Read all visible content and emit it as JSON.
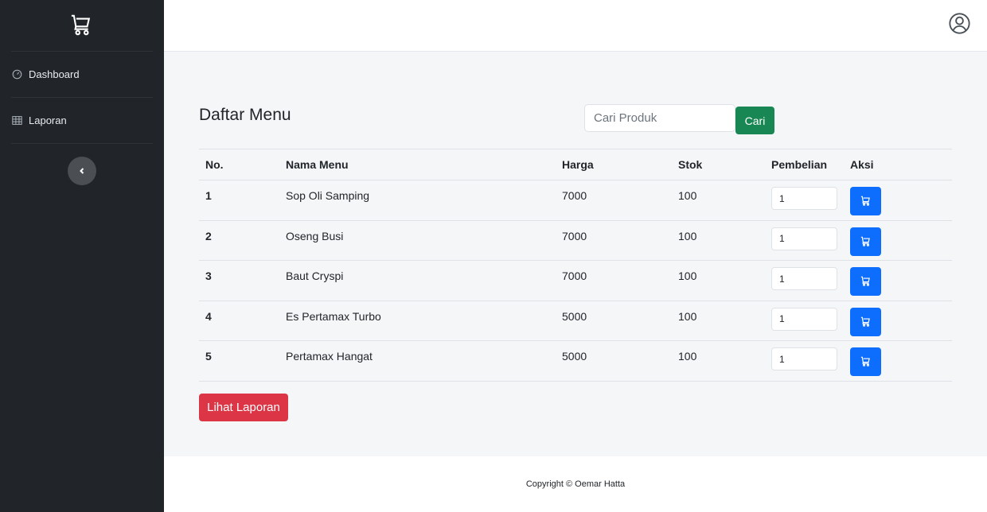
{
  "sidebar": {
    "brand_icon": "cart-icon",
    "items": [
      {
        "label": "Dashboard",
        "icon": "speedometer-icon"
      },
      {
        "label": "Laporan",
        "icon": "table-icon"
      }
    ],
    "toggle_icon": "chevron-left-icon"
  },
  "topbar": {
    "user_icon": "user-circle-icon"
  },
  "main": {
    "title": "Daftar Menu",
    "search": {
      "placeholder": "Cari Produk",
      "value": "",
      "button_label": "Cari"
    },
    "table": {
      "headers": [
        "No.",
        "Nama Menu",
        "Harga",
        "Stok",
        "Pembelian",
        "Aksi"
      ],
      "rows": [
        {
          "no": "1",
          "name": "Sop Oli Samping",
          "price": "7000",
          "stock": "100",
          "qty": "1"
        },
        {
          "no": "2",
          "name": "Oseng Busi",
          "price": "7000",
          "stock": "100",
          "qty": "1"
        },
        {
          "no": "3",
          "name": "Baut Cryspi",
          "price": "7000",
          "stock": "100",
          "qty": "1"
        },
        {
          "no": "4",
          "name": "Es Pertamax Turbo",
          "price": "5000",
          "stock": "100",
          "qty": "1"
        },
        {
          "no": "5",
          "name": "Pertamax Hangat",
          "price": "5000",
          "stock": "100",
          "qty": "1"
        }
      ]
    },
    "report_button": "Lihat Laporan"
  },
  "footer": {
    "text": "Copyright © Oemar Hatta"
  },
  "colors": {
    "sidebar": "#212529",
    "success": "#198754",
    "primary": "#0d6efd",
    "danger": "#dc3545"
  }
}
